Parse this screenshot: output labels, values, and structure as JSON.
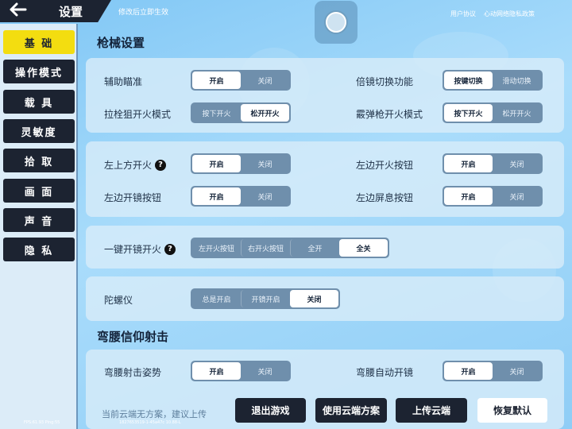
{
  "header": {
    "back_icon": "arrow-left-icon",
    "title": "设置",
    "hint": "修改后立即生效",
    "links": [
      "用户协议",
      "心动网络隐私政策"
    ]
  },
  "sidebar": {
    "items": [
      {
        "label": "基 础",
        "active": true
      },
      {
        "label": "操作模式",
        "active": false
      },
      {
        "label": "载 具",
        "active": false
      },
      {
        "label": "灵敏度",
        "active": false
      },
      {
        "label": "拾 取",
        "active": false
      },
      {
        "label": "画 面",
        "active": false
      },
      {
        "label": "声 音",
        "active": false
      },
      {
        "label": "隐 私",
        "active": false
      }
    ]
  },
  "sections": {
    "gun": "枪械设置",
    "crouch": "弯腰信仰射击"
  },
  "settings": {
    "aim_assist": {
      "label": "辅助瞄准",
      "options": [
        "开启",
        "关闭"
      ],
      "selected": "开启"
    },
    "scope_switch": {
      "label": "倍镜切换功能",
      "options": [
        "按键切换",
        "滑动切换"
      ],
      "selected": "按键切换"
    },
    "bolt_fire": {
      "label": "拉栓狙开火模式",
      "options": [
        "按下开火",
        "松开开火"
      ],
      "selected": "松开开火"
    },
    "shotgun_fire": {
      "label": "霰弹枪开火模式",
      "options": [
        "按下开火",
        "松开开火"
      ],
      "selected": "按下开火"
    },
    "top_left_fire": {
      "label": "左上方开火",
      "options": [
        "开启",
        "关闭"
      ],
      "selected": "开启"
    },
    "left_fire_btn": {
      "label": "左边开火按钮",
      "options": [
        "开启",
        "关闭"
      ],
      "selected": "开启"
    },
    "left_scope_btn": {
      "label": "左边开镜按钮",
      "options": [
        "开启",
        "关闭"
      ],
      "selected": "开启"
    },
    "left_hold_breath": {
      "label": "左边屏息按钮",
      "options": [
        "开启",
        "关闭"
      ],
      "selected": "开启"
    },
    "one_key_scope": {
      "label": "一键开镜开火",
      "options": [
        "左开火按钮",
        "右开火按钮",
        "全开",
        "全关"
      ],
      "selected": "全关"
    },
    "gyroscope": {
      "label": "陀螺仪",
      "options": [
        "总是开启",
        "开镜开启",
        "关闭"
      ],
      "selected": "关闭"
    },
    "crouch_pose": {
      "label": "弯腰射击姿势",
      "options": [
        "开启",
        "关闭"
      ],
      "selected": "开启"
    },
    "crouch_auto_scope": {
      "label": "弯腰自动开镜",
      "options": [
        "开启",
        "关闭"
      ],
      "selected": "开启"
    }
  },
  "footer": {
    "cloud_note": "当前云端无方案，建议上传",
    "buttons": [
      "退出游戏",
      "使用云端方案",
      "上传云端",
      "恢复默认"
    ],
    "fps": "FPS:61.93 Ping:55",
    "build": "1827653519-1-45a47c 10.88-L"
  },
  "colors": {
    "active_tab": "#f3dd10",
    "dark": "#1c2331",
    "toggle_bg": "#6f8fac"
  }
}
